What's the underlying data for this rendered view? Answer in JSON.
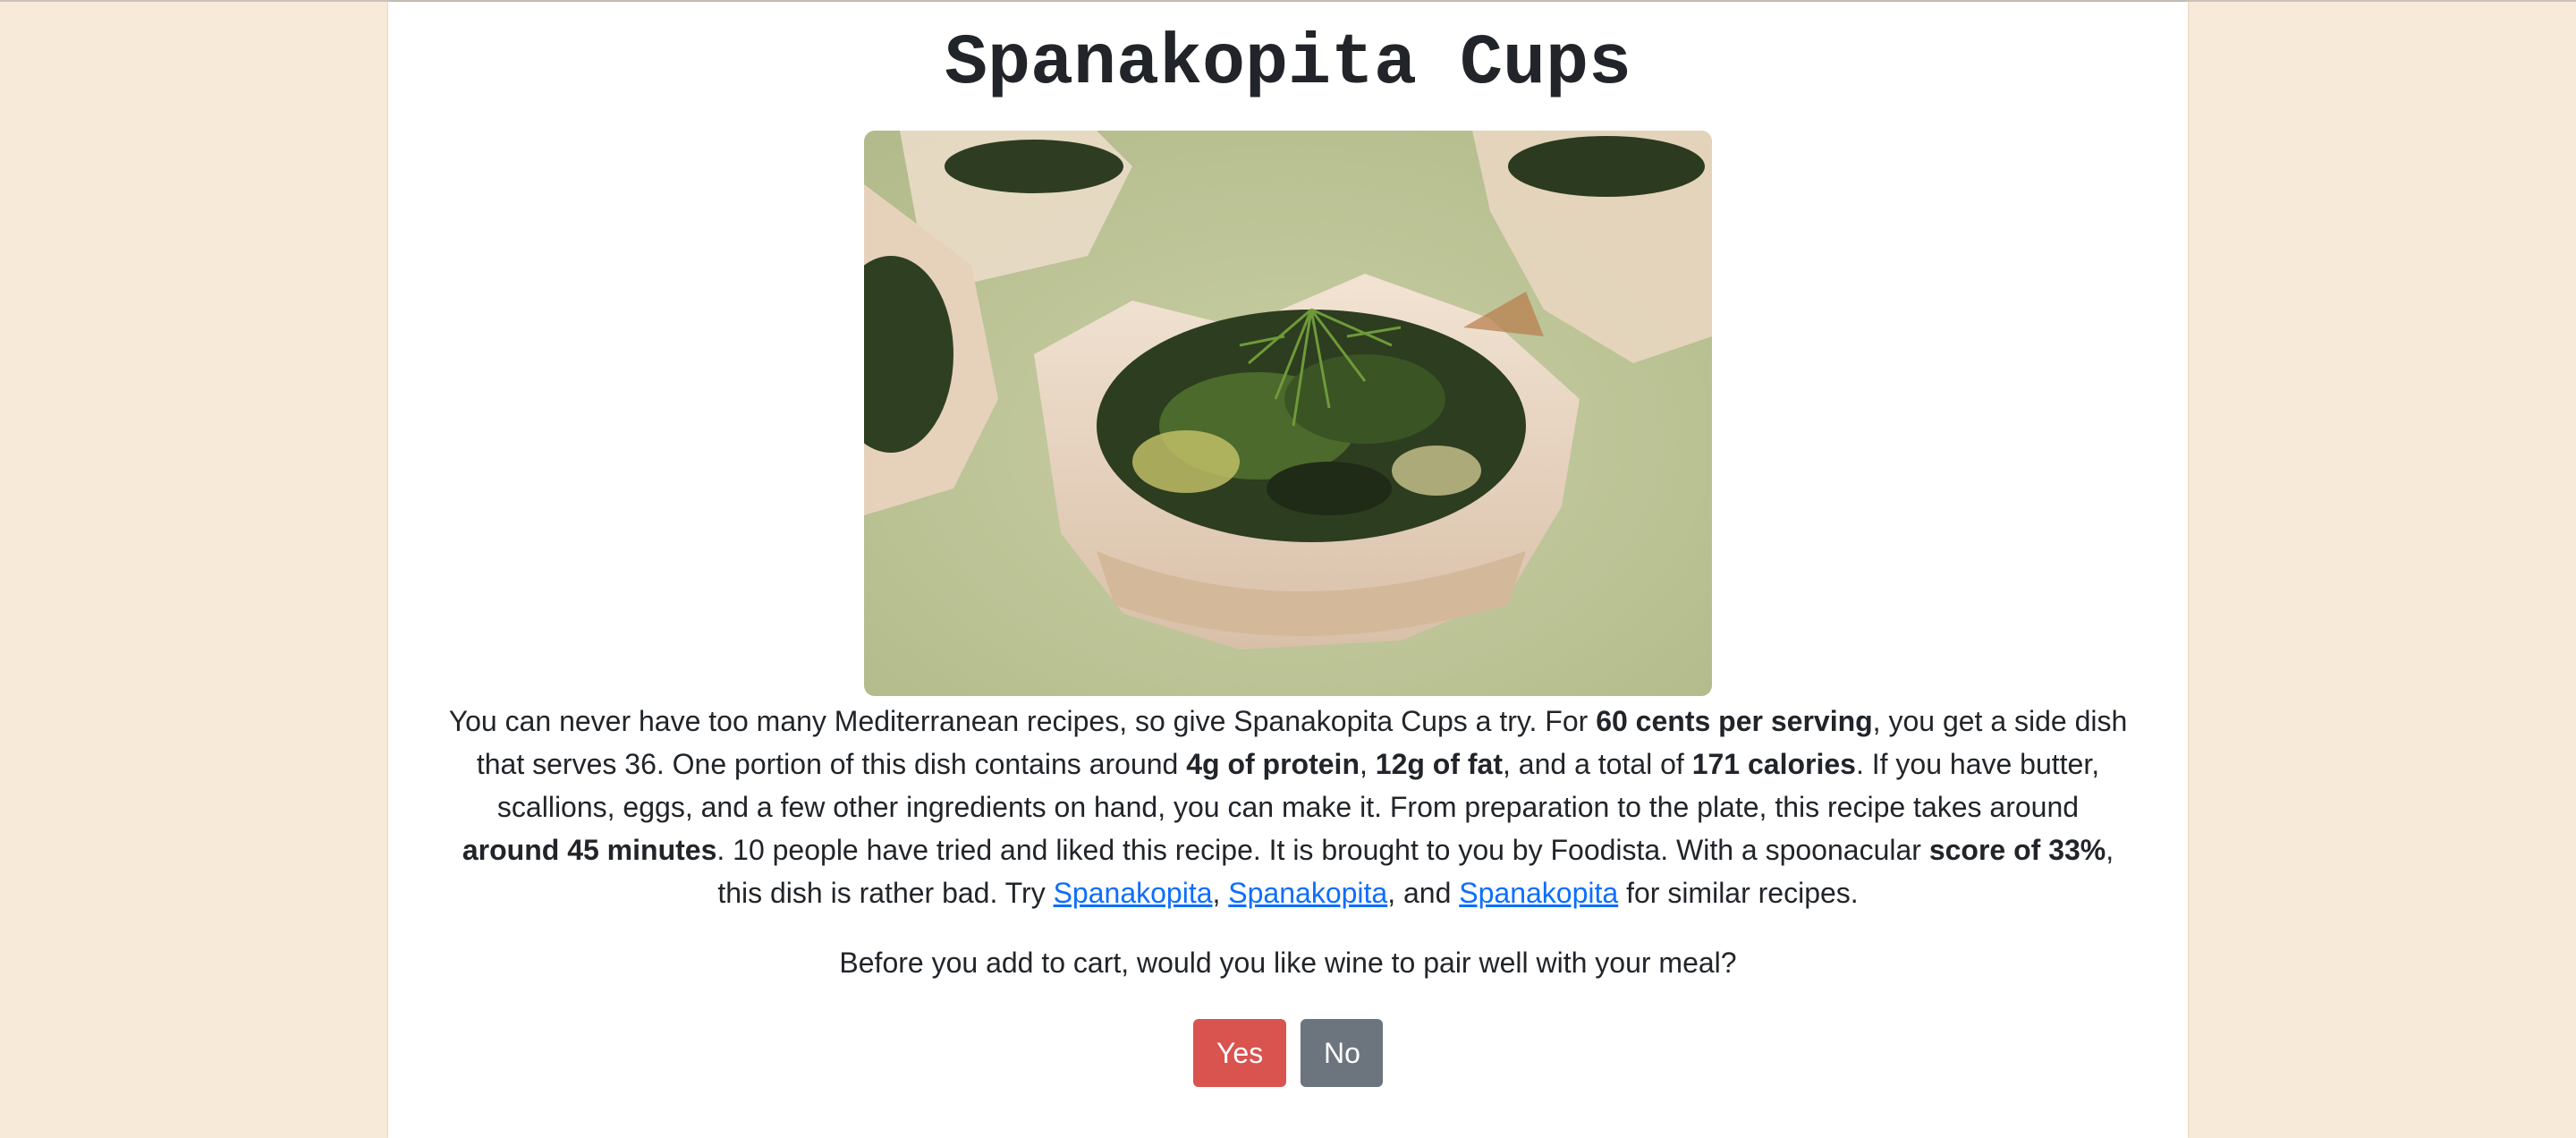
{
  "recipe": {
    "title": "Spanakopita Cups",
    "description": {
      "intro": "You can never have too many Mediterranean recipes, so give Spanakopita Cups a try. For ",
      "price": "60 cents per serving",
      "after_price": ", you get a side dish that serves 36. One portion of this dish contains around ",
      "protein": "4g of protein",
      "comma1": ", ",
      "fat": "12g of fat",
      "after_fat": ", and a total of ",
      "calories": "171 calories",
      "after_calories": ". If you have butter, scallions, eggs, and a few other ingredients on hand, you can make it. From preparation to the plate, this recipe takes around ",
      "time": "around 45 minutes",
      "after_time": ". 10 people have tried and liked this recipe. It is brought to you by Foodista. With a spoonacular ",
      "score": "score of 33%",
      "after_score": ", this dish is rather bad. Try ",
      "similar_links": [
        "Spanakopita",
        "Spanakopita",
        "Spanakopita"
      ],
      "sep1": ", ",
      "sep2": ", and ",
      "outro": " for similar recipes."
    }
  },
  "prompt": {
    "question": "Before you add to cart, would you like wine to pair well with your meal?",
    "yes_label": "Yes",
    "no_label": "No"
  },
  "colors": {
    "page_background": "#f7ead8",
    "yes_button": "#d9534f",
    "no_button": "#6c757d",
    "link": "#0d6efd"
  }
}
